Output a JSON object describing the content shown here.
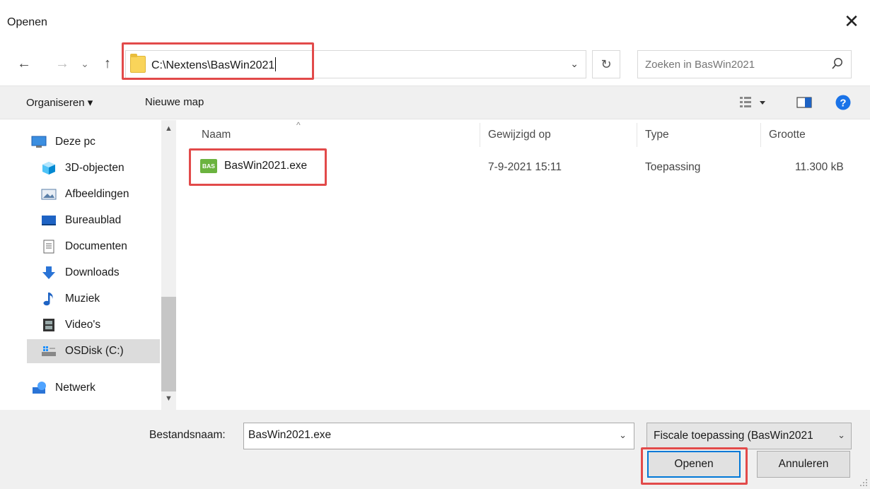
{
  "window": {
    "title": "Openen",
    "close_label": "✕"
  },
  "nav": {
    "back_glyph": "←",
    "forward_glyph": "→",
    "recent_glyph": "⌄",
    "up_glyph": "↑",
    "address_path": "C:\\Nextens\\BasWin2021",
    "refresh_glyph": "↻",
    "search_placeholder": "Zoeken in BasWin2021"
  },
  "toolbar": {
    "organize_label": "Organiseren ▾",
    "new_folder_label": "Nieuwe map"
  },
  "sidebar": {
    "items": [
      {
        "label": "Deze pc",
        "icon": "pc-icon"
      },
      {
        "label": "3D-objecten",
        "icon": "3d-objects-icon"
      },
      {
        "label": "Afbeeldingen",
        "icon": "pictures-icon"
      },
      {
        "label": "Bureaublad",
        "icon": "desktop-icon"
      },
      {
        "label": "Documenten",
        "icon": "documents-icon"
      },
      {
        "label": "Downloads",
        "icon": "downloads-icon"
      },
      {
        "label": "Muziek",
        "icon": "music-icon"
      },
      {
        "label": "Video's",
        "icon": "videos-icon"
      },
      {
        "label": "OSDisk (C:)",
        "icon": "drive-icon",
        "selected": true
      },
      {
        "label": "Netwerk",
        "icon": "network-icon"
      }
    ]
  },
  "files": {
    "columns": {
      "name": "Naam",
      "modified": "Gewijzigd op",
      "type": "Type",
      "size": "Grootte"
    },
    "rows": [
      {
        "name": "BasWin2021.exe",
        "icon_text": "BAS",
        "modified": "7-9-2021 15:11",
        "type": "Toepassing",
        "size": "11.300 kB"
      }
    ]
  },
  "footer": {
    "filename_label": "Bestandsnaam:",
    "filename_value": "BasWin2021.exe",
    "filetype_value": "Fiscale toepassing (BasWin2021",
    "open_label": "Openen",
    "cancel_label": "Annuleren"
  },
  "colors": {
    "highlight_red": "#e24a4a",
    "accent_blue": "#0078d7",
    "help_blue": "#1a73e8",
    "exe_icon_green": "#6bb33f"
  }
}
